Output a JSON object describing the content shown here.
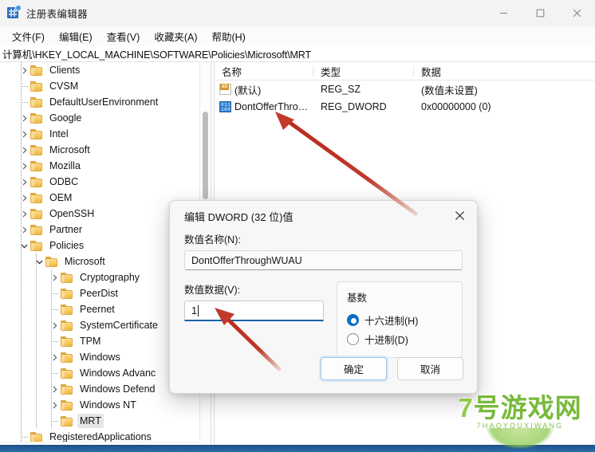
{
  "window": {
    "title": "注册表编辑器",
    "app_icon": "registry-editor-icon",
    "minimize_label": "最小化",
    "maximize_label": "最大化",
    "close_label": "关闭"
  },
  "menu": {
    "items": [
      {
        "label": "文件(F)"
      },
      {
        "label": "编辑(E)"
      },
      {
        "label": "查看(V)"
      },
      {
        "label": "收藏夹(A)"
      },
      {
        "label": "帮助(H)"
      }
    ]
  },
  "address": {
    "path": "计算机\\HKEY_LOCAL_MACHINE\\SOFTWARE\\Policies\\Microsoft\\MRT"
  },
  "tree": {
    "items": [
      {
        "label": "Clients",
        "depth": 1,
        "expander": "collapsed",
        "selected": false
      },
      {
        "label": "CVSM",
        "depth": 1,
        "expander": "none",
        "selected": false
      },
      {
        "label": "DefaultUserEnvironment",
        "depth": 1,
        "expander": "none",
        "selected": false
      },
      {
        "label": "Google",
        "depth": 1,
        "expander": "collapsed",
        "selected": false
      },
      {
        "label": "Intel",
        "depth": 1,
        "expander": "collapsed",
        "selected": false
      },
      {
        "label": "Microsoft",
        "depth": 1,
        "expander": "collapsed",
        "selected": false
      },
      {
        "label": "Mozilla",
        "depth": 1,
        "expander": "collapsed",
        "selected": false
      },
      {
        "label": "ODBC",
        "depth": 1,
        "expander": "collapsed",
        "selected": false
      },
      {
        "label": "OEM",
        "depth": 1,
        "expander": "collapsed",
        "selected": false
      },
      {
        "label": "OpenSSH",
        "depth": 1,
        "expander": "collapsed",
        "selected": false
      },
      {
        "label": "Partner",
        "depth": 1,
        "expander": "collapsed",
        "selected": false
      },
      {
        "label": "Policies",
        "depth": 1,
        "expander": "expanded",
        "selected": false
      },
      {
        "label": "Microsoft",
        "depth": 2,
        "expander": "expanded",
        "selected": false
      },
      {
        "label": "Cryptography",
        "depth": 3,
        "expander": "collapsed",
        "selected": false
      },
      {
        "label": "PeerDist",
        "depth": 3,
        "expander": "none",
        "selected": false
      },
      {
        "label": "Peernet",
        "depth": 3,
        "expander": "none",
        "selected": false
      },
      {
        "label": "SystemCertificate",
        "depth": 3,
        "expander": "collapsed",
        "selected": false
      },
      {
        "label": "TPM",
        "depth": 3,
        "expander": "none",
        "selected": false
      },
      {
        "label": "Windows",
        "depth": 3,
        "expander": "collapsed",
        "selected": false
      },
      {
        "label": "Windows Advanc",
        "depth": 3,
        "expander": "none",
        "selected": false
      },
      {
        "label": "Windows Defend",
        "depth": 3,
        "expander": "collapsed",
        "selected": false
      },
      {
        "label": "Windows NT",
        "depth": 3,
        "expander": "collapsed",
        "selected": false
      },
      {
        "label": "MRT",
        "depth": 3,
        "expander": "none",
        "selected": true
      },
      {
        "label": "RegisteredApplications",
        "depth": 1,
        "expander": "none",
        "selected": false
      }
    ]
  },
  "list": {
    "columns": [
      "名称",
      "类型",
      "数据"
    ],
    "rows": [
      {
        "icon": "string-value-icon",
        "name": "(默认)",
        "type": "REG_SZ",
        "data": "(数值未设置)"
      },
      {
        "icon": "dword-value-icon",
        "name": "DontOfferThro…",
        "type": "REG_DWORD",
        "data": "0x00000000 (0)"
      }
    ]
  },
  "dialog": {
    "title": "编辑 DWORD (32 位)值",
    "close_label": "关闭",
    "name_label": "数值名称(N):",
    "name_value": "DontOfferThroughWUAU",
    "data_label": "数值数据(V):",
    "data_value": "1",
    "base_group_label": "基数",
    "radios": [
      {
        "label": "十六进制(H)",
        "selected": true
      },
      {
        "label": "十进制(D)",
        "selected": false
      }
    ],
    "ok_label": "确定",
    "cancel_label": "取消"
  },
  "watermark": {
    "digit": "7",
    "text_a": "号",
    "text_b": "游戏网",
    "subtitle": "7HAOYOUXIWANG",
    "color": "#6fb52e"
  },
  "annotations": {
    "arrow_color": "#c0392b",
    "arrows": [
      {
        "name": "arrow-to-dword-entry"
      },
      {
        "name": "arrow-to-value-data-field"
      }
    ]
  }
}
